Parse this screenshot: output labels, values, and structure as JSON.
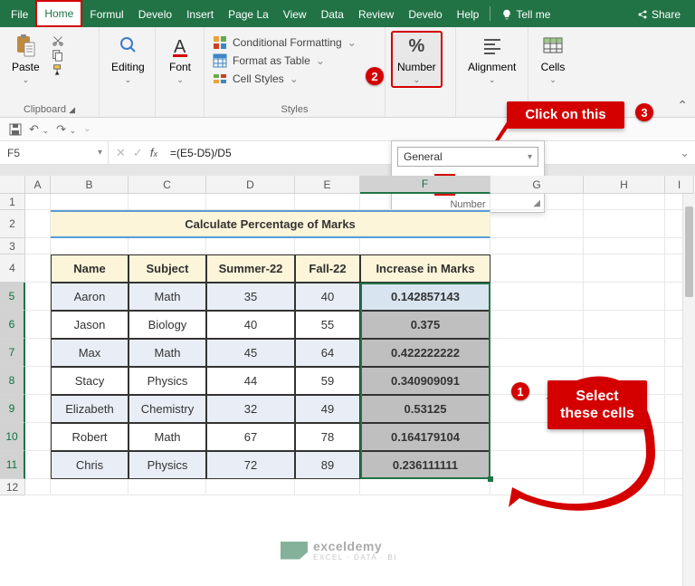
{
  "tabs": [
    "File",
    "Home",
    "Formulas",
    "Developer",
    "Insert",
    "Page Layout",
    "View",
    "Data",
    "Review",
    "Developer",
    "Help"
  ],
  "tabs_short": [
    "File",
    "Home",
    "Formul",
    "Develo",
    "Insert",
    "Page La",
    "View",
    "Data",
    "Review",
    "Develo",
    "Help"
  ],
  "tellme": "Tell me",
  "share": "Share",
  "ribbon": {
    "clipboard": {
      "paste": "Paste",
      "label": "Clipboard"
    },
    "editing": {
      "btn": "Editing"
    },
    "font": {
      "btn": "Font"
    },
    "styles": {
      "cond": "Conditional Formatting",
      "table": "Format as Table",
      "cellstyles": "Cell Styles",
      "label": "Styles"
    },
    "number": {
      "btn": "Number"
    },
    "alignment": {
      "btn": "Alignment"
    },
    "cells": {
      "btn": "Cells"
    }
  },
  "numpop": {
    "format": "General",
    "label": "Number",
    "currency": "$",
    "percent": "%",
    "comma": ",",
    "inc": "increase-decimal",
    "dec": "decrease-decimal"
  },
  "namebox": "F5",
  "formula": "=(E5-D5)/D5",
  "columns": [
    "A",
    "B",
    "C",
    "D",
    "E",
    "F",
    "G",
    "H",
    "I"
  ],
  "rows": [
    "1",
    "2",
    "3",
    "4",
    "5",
    "6",
    "7",
    "8",
    "9",
    "10",
    "11",
    "12"
  ],
  "title": "Calculate Percentage of Marks",
  "headers": [
    "Name",
    "Subject",
    "Summer-22",
    "Fall-22",
    "Increase in Marks"
  ],
  "data": [
    [
      "Aaron",
      "Math",
      "35",
      "40",
      "0.142857143"
    ],
    [
      "Jason",
      "Biology",
      "40",
      "55",
      "0.375"
    ],
    [
      "Max",
      "Math",
      "45",
      "64",
      "0.422222222"
    ],
    [
      "Stacy",
      "Physics",
      "44",
      "59",
      "0.340909091"
    ],
    [
      "Elizabeth",
      "Chemistry",
      "32",
      "49",
      "0.53125"
    ],
    [
      "Robert",
      "Math",
      "67",
      "78",
      "0.164179104"
    ],
    [
      "Chris",
      "Physics",
      "72",
      "89",
      "0.236111111"
    ]
  ],
  "callouts": {
    "c1": "1",
    "c2": "2",
    "c3": "3",
    "click": "Click on this",
    "select": "Select\nthese cells"
  },
  "watermark": {
    "name": "exceldemy",
    "sub": "EXCEL · DATA · BI"
  },
  "chart_data": {
    "type": "table",
    "title": "Calculate Percentage of Marks",
    "columns": [
      "Name",
      "Subject",
      "Summer-22",
      "Fall-22",
      "Increase in Marks"
    ],
    "rows": [
      {
        "Name": "Aaron",
        "Subject": "Math",
        "Summer-22": 35,
        "Fall-22": 40,
        "Increase in Marks": 0.142857143
      },
      {
        "Name": "Jason",
        "Subject": "Biology",
        "Summer-22": 40,
        "Fall-22": 55,
        "Increase in Marks": 0.375
      },
      {
        "Name": "Max",
        "Subject": "Math",
        "Summer-22": 45,
        "Fall-22": 64,
        "Increase in Marks": 0.422222222
      },
      {
        "Name": "Stacy",
        "Subject": "Physics",
        "Summer-22": 44,
        "Fall-22": 59,
        "Increase in Marks": 0.340909091
      },
      {
        "Name": "Elizabeth",
        "Subject": "Chemistry",
        "Summer-22": 32,
        "Fall-22": 49,
        "Increase in Marks": 0.53125
      },
      {
        "Name": "Robert",
        "Subject": "Math",
        "Summer-22": 67,
        "Fall-22": 78,
        "Increase in Marks": 0.164179104
      },
      {
        "Name": "Chris",
        "Subject": "Physics",
        "Summer-22": 72,
        "Fall-22": 89,
        "Increase in Marks": 0.236111111
      }
    ]
  }
}
